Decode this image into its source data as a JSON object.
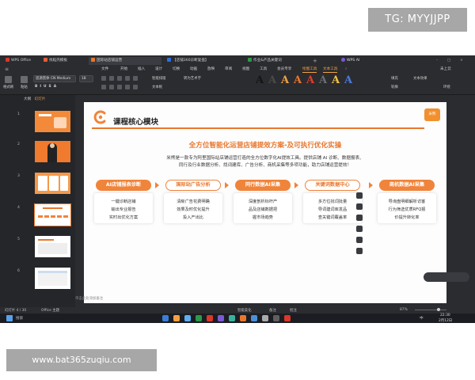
{
  "watermark_top": "TG: MYYJJPP",
  "watermark_bottom": "www.bat365zuqiu.com",
  "window": {
    "tabs": [
      {
        "label": "WPS Office",
        "color": "#d9382a"
      },
      {
        "label": "找稻壳模板",
        "color": "#e0603a"
      },
      {
        "label": "国际站店铺运营",
        "color": "#e8772e"
      },
      {
        "label": "【店铺360诊断复盘】",
        "color": "#2f6fde"
      },
      {
        "label": "作业&产品关键词",
        "color": "#2a9a4a"
      }
    ],
    "ai_label": "WPS AI"
  },
  "menu": {
    "items": [
      "文件",
      "开始",
      "插入",
      "设计",
      "切换",
      "动画",
      "放映",
      "审阅",
      "视图",
      "工具",
      "会员专享",
      "绘图工具",
      "文本工具"
    ],
    "highlight": [
      "绘图工具",
      "文本工具"
    ],
    "right": "未上云"
  },
  "toolbar": {
    "format_label": "格式刷",
    "paste_label": "粘贴",
    "font_name": "思源黑体 CN Medium",
    "font_size": "18",
    "smart_format": "智能排版",
    "text_box": "文本框",
    "convert_art": "转为艺术字",
    "text_effect": "文本效果",
    "fill": "填充",
    "outline": "轮廓",
    "wrap": "环绕",
    "art_colors": [
      "#151515",
      "#4a4a4a",
      "#f2a144",
      "#e8772e",
      "#e23b2a",
      "#6e6e6e",
      "#f6c244",
      "#4a7bd8"
    ]
  },
  "panel": {
    "tabs": [
      "大纲",
      "幻灯片"
    ],
    "active": "幻灯片",
    "thumb_numbers": [
      "1",
      "2",
      "3",
      "4",
      "5",
      "6"
    ]
  },
  "slide": {
    "title": "课程核心模块",
    "badge": "米熊",
    "headline": "全方位智能化运营店铺提效方案-及可执行优化实操",
    "desc_lines": [
      "米熊是一款专为阿里国际站店铺运营打造的全方位数字化AI提效工具。提供店铺 AI 诊断、数据报表、",
      "同行及行业数据分析、找词建库、广告分析、商机采集等多项功能，助力店铺运营提效！"
    ],
    "modules": [
      {
        "title": "AI店铺报表诊断",
        "lines": [
          "一键诊断店铺",
          "输出专业报告",
          "实时出优化方案"
        ],
        "hollow": false
      },
      {
        "title": "国际站广告分析",
        "lines": [
          "清晰广告花费明确",
          "效果及时优化提升",
          "投入产出比"
        ],
        "hollow": true
      },
      {
        "title": "同行数据AI采集",
        "lines": [
          "深度剖析标杆产",
          "品及店铺数据把",
          "握市场趋势"
        ],
        "hollow": false
      },
      {
        "title": "关键词数据中心",
        "lines": [
          "多方位找词批量",
          "导词建词库发品",
          "查关键词覆盖率"
        ],
        "hollow": true
      },
      {
        "title": "商机数据AI采集",
        "lines": [
          "导询盘明细解析访客",
          "行为筛选优质RFQ报",
          "价提升转化率"
        ],
        "hollow": false
      }
    ]
  },
  "notes_placeholder": "单击此处添加备注",
  "status": {
    "page": "幻灯片 4 / 30",
    "theme": "Office 主题",
    "zoom": "87%",
    "smart_beautify": "智能美化",
    "remark": "备注",
    "comment": "批注"
  },
  "taskbar": {
    "search": "搜索",
    "time": "22:30",
    "date": "2月12日",
    "lang": "中",
    "icon_colors": [
      "#3b7dd8",
      "#f2a144",
      "#5bb0f0",
      "#2a9a4a",
      "#d9382a",
      "#7a5ad8",
      "#3bb0a0",
      "#e8772e",
      "#4a90d9",
      "#aaaaaa",
      "#5f5f5f",
      "#d9382a"
    ]
  }
}
